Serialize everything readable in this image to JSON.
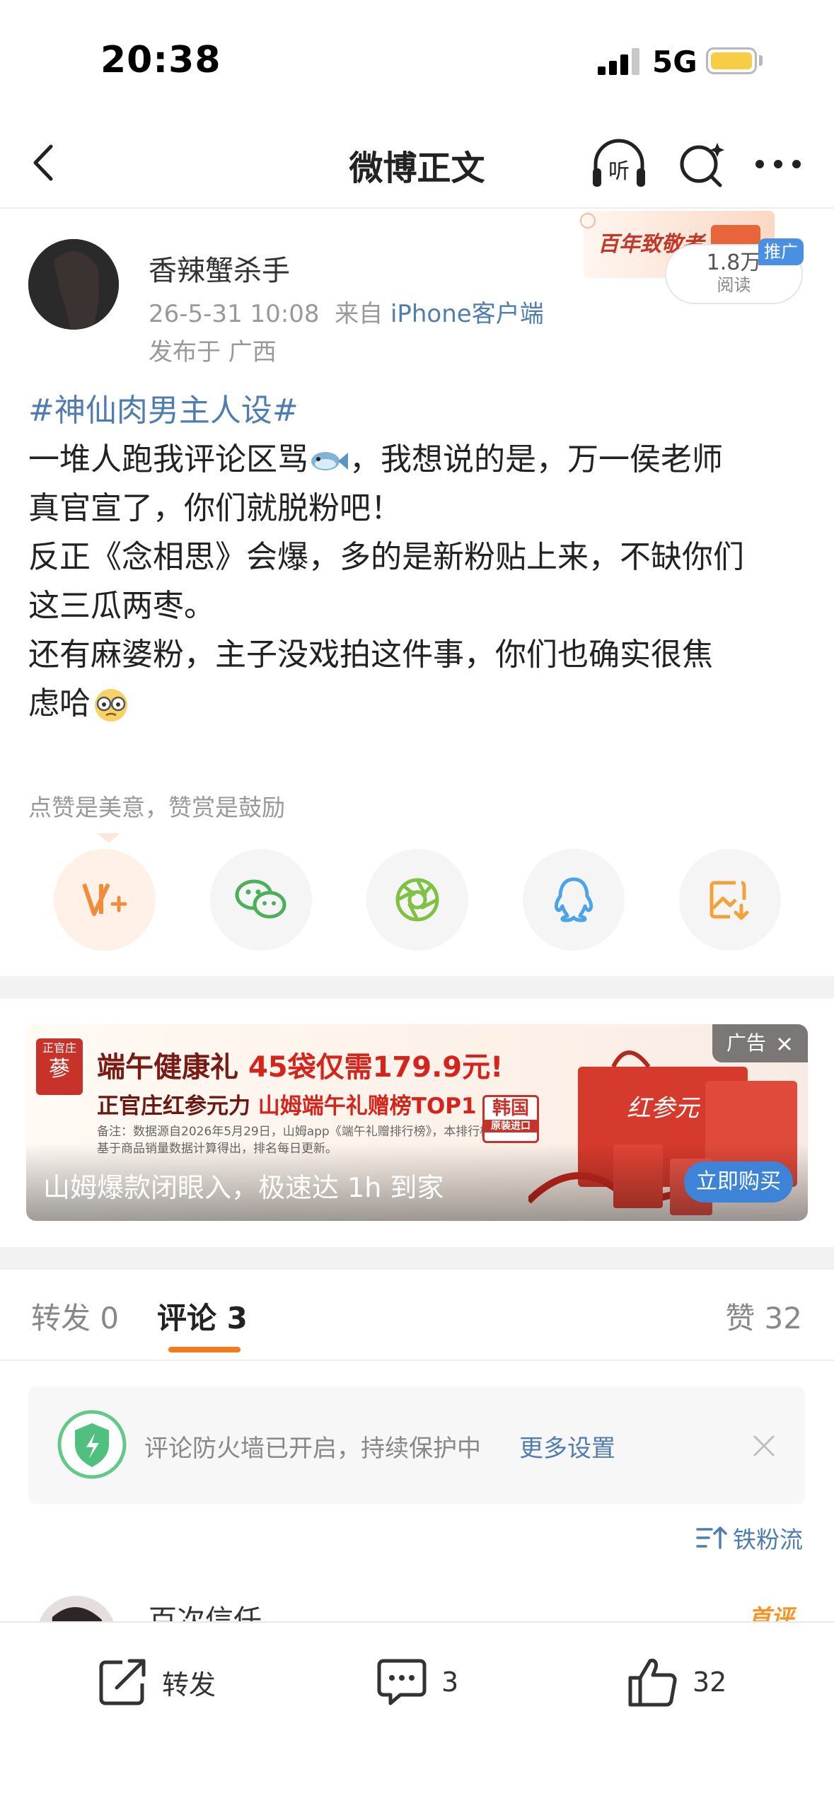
{
  "status_bar": {
    "time": "20:38",
    "network": "5G",
    "battery_color": "#f7cd45"
  },
  "nav": {
    "title": "微博正文",
    "listen_label": "听"
  },
  "post": {
    "author": "香辣蟹杀手",
    "time": "26-5-31 10:08",
    "source_prefix": "来自",
    "source": "iPhone客户端",
    "location": "发布于 广西",
    "promo_text": "百年致敬者",
    "read_count": "1.8万",
    "read_label": "阅读",
    "ad_tag": "推广",
    "topic": "#神仙肉男主人设#",
    "line1": "一堆人跑我评论区骂",
    "line1b": "，我想说的是，万一侯老师",
    "line2": "真官宣了，你们就脱粉吧！",
    "line3": "反正《念相思》会爆，多的是新粉贴上来，不缺你们",
    "line4": "这三瓜两枣。",
    "line5": "还有麻婆粉，主子没戏拍这件事，你们也确实很焦",
    "line6": "虑哈",
    "hint": "点赞是美意，赞赏是鼓励"
  },
  "share_icons": [
    "weibo-plus-icon",
    "wechat-icon",
    "moments-icon",
    "qq-icon",
    "save-image-icon"
  ],
  "ad": {
    "logo_text": "正官庄",
    "logo_char": "蔘",
    "headline_a": "端午健康礼 ",
    "headline_b": "45袋仅需179.9元!",
    "sub_a": "正官庄红参元力 ",
    "sub_b": "山姆端午礼赠榜TOP1",
    "note": "备注：数据源自2026年5月29日，山姆app《端午礼赠排行榜》，本排行榜基于商品销量数据计算得出，排名每日更新。",
    "stamp": "韩国",
    "stamp_sub": "原装进口",
    "product_text": "红参元",
    "caption": "山姆爆款闭眼入，极速达 1h 到家",
    "cta": "立即购买",
    "label": "广告"
  },
  "tabs": {
    "repost": "转发 0",
    "comment": "评论 3",
    "like": "赞 32"
  },
  "firewall": {
    "text": "评论防火墙已开启，持续保护中",
    "link": "更多设置"
  },
  "sort_label": "铁粉流",
  "comment_preview": {
    "name": "百次信任",
    "badge": "首评"
  },
  "bottom_bar": {
    "repost": "转发",
    "comment_count": "3",
    "like_count": "32"
  },
  "colors": {
    "link": "#507daf",
    "accent": "#f37b1d",
    "ad_blue": "#3d84d9"
  }
}
